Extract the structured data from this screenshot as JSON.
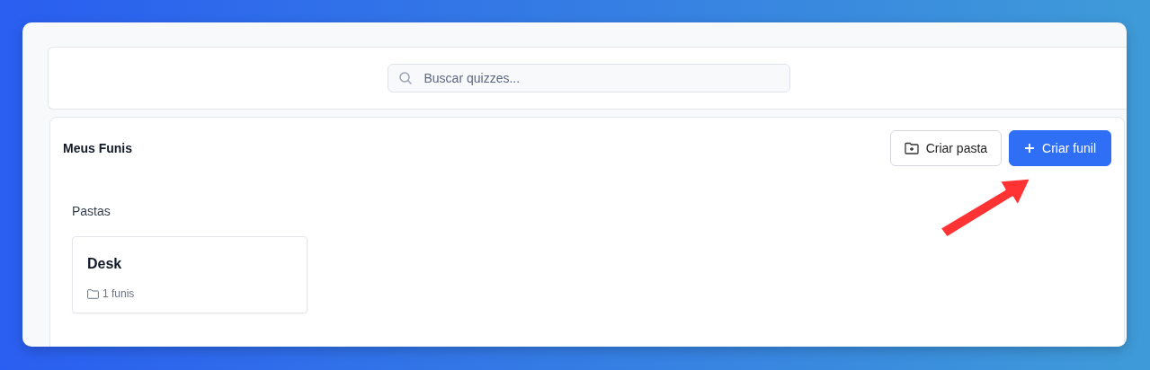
{
  "search": {
    "placeholder": "Buscar quizzes..."
  },
  "header": {
    "title": "Meus Funis",
    "buttons": [
      {
        "label": "Criar pasta",
        "kind": "outline"
      },
      {
        "label": "Criar funil",
        "kind": "primary"
      }
    ]
  },
  "folders_section": {
    "title": "Pastas"
  },
  "folders": [
    {
      "name": "Desk",
      "count": "1 funis"
    }
  ]
}
